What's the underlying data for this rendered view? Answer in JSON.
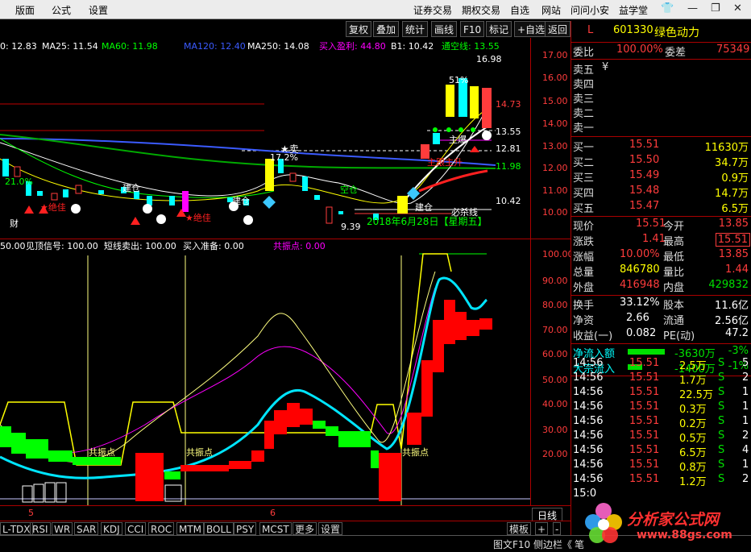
{
  "menu": {
    "items": [
      "版面",
      "公式",
      "设置",
      "证券交易",
      "期权交易",
      "自选",
      "网站",
      "问问小安",
      "益学堂"
    ]
  },
  "toolbar": {
    "buttons": [
      "复权",
      "叠加",
      "统计",
      "画线",
      "F10",
      "标记",
      "+自选",
      "返回"
    ]
  },
  "ma_line": [
    {
      "text": "0: 12.83",
      "color": "#ffffff"
    },
    {
      "text": "MA25: 11.54",
      "color": "#ffffff"
    },
    {
      "text": "MA60: 11.98",
      "color": "#00ff00"
    },
    {
      "text": "MA120: 12.40",
      "color": "#3b5bff"
    },
    {
      "text": "MA250: 14.08",
      "color": "#ffffff"
    },
    {
      "text": "买入盈利: 44.80",
      "color": "#ff00ff"
    },
    {
      "text": "B1: 10.42",
      "color": "#ffffff"
    },
    {
      "text": "通空线: 13.55",
      "color": "#00ff00"
    }
  ],
  "main_axis": {
    "labels": [
      "17.00",
      "16.00",
      "15.00",
      "14.00",
      "13.00",
      "12.00",
      "11.00",
      "10.00"
    ]
  },
  "main_annotations": {
    "peak": "16.98",
    "low": "9.39",
    "pct": "51%",
    "pct2": "17.2%",
    "date": "2018年6月28日【星期五】",
    "mai": "★卖",
    "jiancang1": "建仓",
    "jiancang2": "建仓",
    "jiancang3": "建仓",
    "juejia1": "★绝佳",
    "juejia2": "★绝佳",
    "kongcang": "空仓",
    "zhubao": "主爆",
    "zhuguo": "主跟主升",
    "bishaxian": "必杀线",
    "cai": "财",
    "p1473": "14.73",
    "p1355": "13.55",
    "p1281": "12.81",
    "p1198": "11.98",
    "p1042": "10.42",
    "pct21": "21.0%"
  },
  "ind_line": [
    {
      "text": "50.00",
      "color": "#ffffff"
    },
    {
      "text": "见顶信号: 100.00",
      "color": "#ffffff"
    },
    {
      "text": "短线卖出: 100.00",
      "color": "#ffffff"
    },
    {
      "text": "买入准备: 0.00",
      "color": "#ffffff"
    },
    {
      "text": "共振点: 0.00",
      "color": "#ff00ff"
    }
  ],
  "ind_axis": {
    "labels": [
      "100.00",
      "90.00",
      "80.00",
      "70.00",
      "60.00",
      "50.00",
      "40.00",
      "30.00",
      "20.00"
    ]
  },
  "ind_annotations": {
    "gz1": "共振点",
    "gz2": "共振点",
    "gz3": "共振点"
  },
  "xaxis": {
    "m5": "5",
    "m6": "6",
    "period": "日线"
  },
  "tabs": [
    "L-TDX",
    "RSI",
    "WR",
    "SAR",
    "KDJ",
    "CCI",
    "ROC",
    "MTM",
    "BOLL",
    "PSY",
    "MCST",
    "更多",
    "设置"
  ],
  "tabs_right": [
    "模板",
    "+",
    "-"
  ],
  "status": {
    "left": "图文F10 侧边栏《",
    "right": "笔"
  },
  "quote": {
    "flag": "L",
    "code": "601330",
    "name": "绿色动力",
    "webi_label": "委比",
    "webi": "100.00%",
    "wecha_label": "委差",
    "wecha": "75349",
    "sell": [
      {
        "label": "卖五",
        "price": "",
        "vol": "",
        "mark": "¥"
      },
      {
        "label": "卖四",
        "price": "",
        "vol": ""
      },
      {
        "label": "卖三",
        "price": "",
        "vol": ""
      },
      {
        "label": "卖二",
        "price": "",
        "vol": ""
      },
      {
        "label": "卖一",
        "price": "",
        "vol": ""
      }
    ],
    "buy": [
      {
        "label": "买一",
        "price": "15.51",
        "vol": "11630万"
      },
      {
        "label": "买二",
        "price": "15.50",
        "vol": "34.7万"
      },
      {
        "label": "买三",
        "price": "15.49",
        "vol": "0.9万"
      },
      {
        "label": "买四",
        "price": "15.48",
        "vol": "14.7万"
      },
      {
        "label": "买五",
        "price": "15.47",
        "vol": "6.5万"
      }
    ],
    "stats": [
      {
        "l1": "现价",
        "v1": "15.51",
        "c1": "red",
        "l2": "今开",
        "v2": "13.85",
        "c2": "red"
      },
      {
        "l1": "涨跌",
        "v1": "1.41",
        "c1": "red",
        "l2": "最高",
        "v2": "15.51",
        "c2": "red",
        "box2": true
      },
      {
        "l1": "涨幅",
        "v1": "10.00%",
        "c1": "red",
        "l2": "最低",
        "v2": "13.85",
        "c2": "red"
      },
      {
        "l1": "总量",
        "v1": "846780",
        "c1": "yel",
        "l2": "量比",
        "v2": "1.44",
        "c2": "red"
      },
      {
        "l1": "外盘",
        "v1": "416948",
        "c1": "red",
        "l2": "内盘",
        "v2": "429832",
        "c2": "grn"
      }
    ],
    "stats2": [
      {
        "l1": "换手",
        "v1": "33.12%",
        "c1": "wht",
        "l2": "股本",
        "v2": "11.6亿",
        "c2": "wht"
      },
      {
        "l1": "净资",
        "v1": "2.66",
        "c1": "wht",
        "l2": "流通",
        "v2": "2.56亿",
        "c2": "wht"
      },
      {
        "l1": "收益(一)",
        "v1": "0.082",
        "c1": "wht",
        "l2": "PE(动)",
        "v2": "47.2",
        "c2": "wht"
      }
    ],
    "flow": [
      {
        "label": "净流入额",
        "value": "-3630万",
        "pct": "-3%"
      },
      {
        "label": "大宗流入",
        "value": "-1400万",
        "pct": "-1%"
      }
    ],
    "ticks": [
      {
        "t": "14:56",
        "p": "15.51",
        "v": "2.5万",
        "s": "S",
        "n": "5"
      },
      {
        "t": "14:56",
        "p": "15.51",
        "v": "1.7万",
        "s": "S",
        "n": "2"
      },
      {
        "t": "14:56",
        "p": "15.51",
        "v": "22.5万",
        "s": "S",
        "n": "1"
      },
      {
        "t": "14:56",
        "p": "15.51",
        "v": "0.3万",
        "s": "S",
        "n": "1"
      },
      {
        "t": "14:56",
        "p": "15.51",
        "v": "0.2万",
        "s": "S",
        "n": "1"
      },
      {
        "t": "14:56",
        "p": "15.51",
        "v": "0.5万",
        "s": "S",
        "n": "2"
      },
      {
        "t": "14:56",
        "p": "15.51",
        "v": "6.5万",
        "s": "S",
        "n": "4"
      },
      {
        "t": "14:56",
        "p": "15.51",
        "v": "0.8万",
        "s": "S",
        "n": "1"
      },
      {
        "t": "14:56",
        "p": "15.51",
        "v": "1.2万",
        "s": "S",
        "n": "2"
      },
      {
        "t": "15:0",
        "p": "",
        "v": "",
        "s": "",
        "n": ""
      }
    ]
  },
  "watermark": {
    "text": "分析家公式网",
    "url": "www.88gs.com"
  },
  "colors": {
    "up": "#ff3c3c",
    "down": "#00e000",
    "bg": "#000000",
    "border": "#aa0000"
  }
}
